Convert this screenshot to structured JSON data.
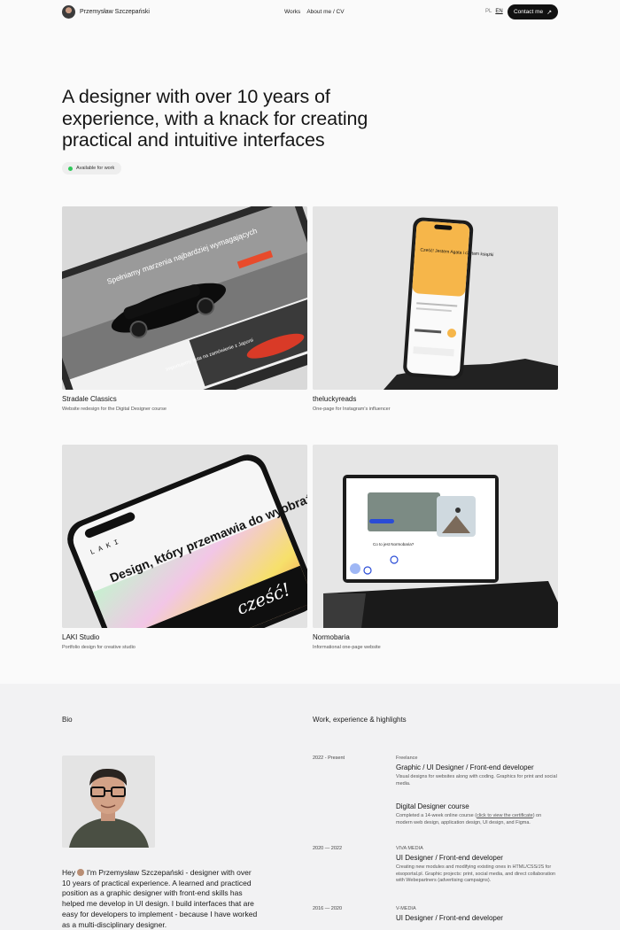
{
  "header": {
    "name": "Przemysław Szczepański",
    "nav": [
      "Works",
      "About me / CV"
    ],
    "lang": [
      "PL",
      "EN"
    ],
    "contact_label": "Contact me",
    "contact_icon": "arrow-up-right-icon"
  },
  "hero": {
    "title": "A designer with over 10 years of experience, with a knack for creating practical and intuitive interfaces",
    "badge": "Available for work",
    "badge_color": "#2fc85a"
  },
  "projects": [
    {
      "title": "Stradale Classics",
      "subtitle": "Website redesign for the Digital Designer course",
      "headline": "Spełniamy marzenia najbardziej wymagających",
      "subline": "Importujemy auta na zamówienie z Japonii"
    },
    {
      "title": "theluckyreads",
      "subtitle": "One-page for Instagram's influencer",
      "headline": "Cześć! Jestem Agata i czytam książki",
      "accent": "#f6b64a"
    },
    {
      "title": "LAKI Studio",
      "subtitle": "Portfolio design for creative studio",
      "headline": "Design, który przemawia do wyobraźni",
      "logo": "L A K I",
      "script": "cześć!"
    },
    {
      "title": "Normobaria",
      "subtitle": "Informational one-page website",
      "headline": "Co to jest Normobaria?"
    }
  ],
  "bio": {
    "label": "Bio",
    "text": "Hey 👋 I'm Przemysław Szczepański - designer with over 10 years of practical experience. A learned and practiced position as a graphic designer with front-end skills has helped me develop in UI design. I build interfaces that are easy for developers to implement - because I have worked as a multi-disciplinary designer.",
    "text_before_icon": "Hey ",
    "text_after_icon": " I'm Przemysław Szczepański - designer with over 10 years of practical experience. A learned and practiced position as a graphic designer with front-end skills has helped me develop in UI design. I build interfaces that are easy for developers to implement - because I have worked as a multi-disciplinary designer."
  },
  "experience": {
    "label": "Work, experience & highlights",
    "items": [
      {
        "date": "2022 - Present",
        "org": "Freelance",
        "role": "Graphic / UI Designer / Front-end developer",
        "desc": "Visual designs for websites along with coding. Graphics for print and social media."
      },
      {
        "date": "",
        "org": "",
        "role": "Digital Designer course",
        "desc_before": "Completed a 14-week online course (",
        "desc_link": "click to view the certificate",
        "desc_after": ") on modern web design, application design, UI design, and Figma."
      },
      {
        "date": "2020 — 2022",
        "org": "VIVA MEDIA",
        "role": "UI Designer / Front-end developer",
        "desc": "Creating new modules and modifying existing ones in HTML/CSS/JS for eisoportal.pl. Graphic projects: print, social media, and direct collaboration with Webepartners (advertising campaigns)."
      },
      {
        "date": "2016 — 2020",
        "org": "V-MEDIA",
        "role": "UI Designer / Front-end developer",
        "desc": ""
      }
    ]
  }
}
